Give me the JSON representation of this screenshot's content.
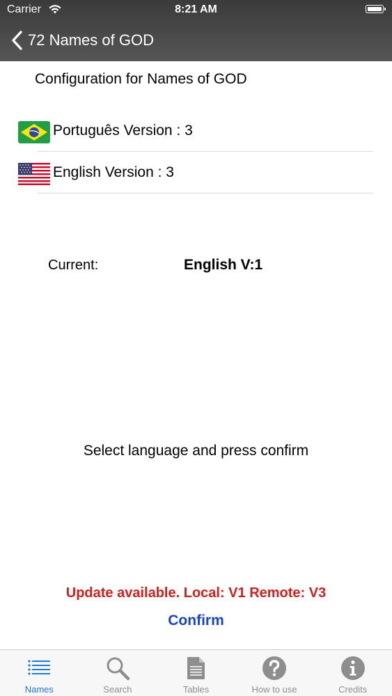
{
  "status_bar": {
    "carrier": "Carrier",
    "time": "8:21 AM"
  },
  "nav": {
    "back_label": "72 Names of GOD"
  },
  "config": {
    "title": "Configuration for Names of GOD",
    "languages": [
      {
        "label": "Português Version : 3",
        "flag": "brazil-flag-icon"
      },
      {
        "label": "English Version : 3",
        "flag": "usa-flag-icon"
      }
    ]
  },
  "current": {
    "label": "Current:",
    "value": "English V:1"
  },
  "instruction": "Select language and press confirm",
  "update_message": "Update available. Local: V1 Remote: V3",
  "confirm_label": "Confirm",
  "tabs": [
    {
      "label": "Names",
      "icon": "list-icon",
      "active": true
    },
    {
      "label": "Search",
      "icon": "magnifier-icon",
      "active": false
    },
    {
      "label": "Tables",
      "icon": "document-icon",
      "active": false
    },
    {
      "label": "How to use",
      "icon": "question-icon",
      "active": false
    },
    {
      "label": "Credits",
      "icon": "info-icon",
      "active": false
    }
  ],
  "colors": {
    "update_red": "#d0201d",
    "confirm_blue": "#1a44c8",
    "tab_active": "#1f7ad6",
    "tab_inactive": "#8e8e8e"
  }
}
